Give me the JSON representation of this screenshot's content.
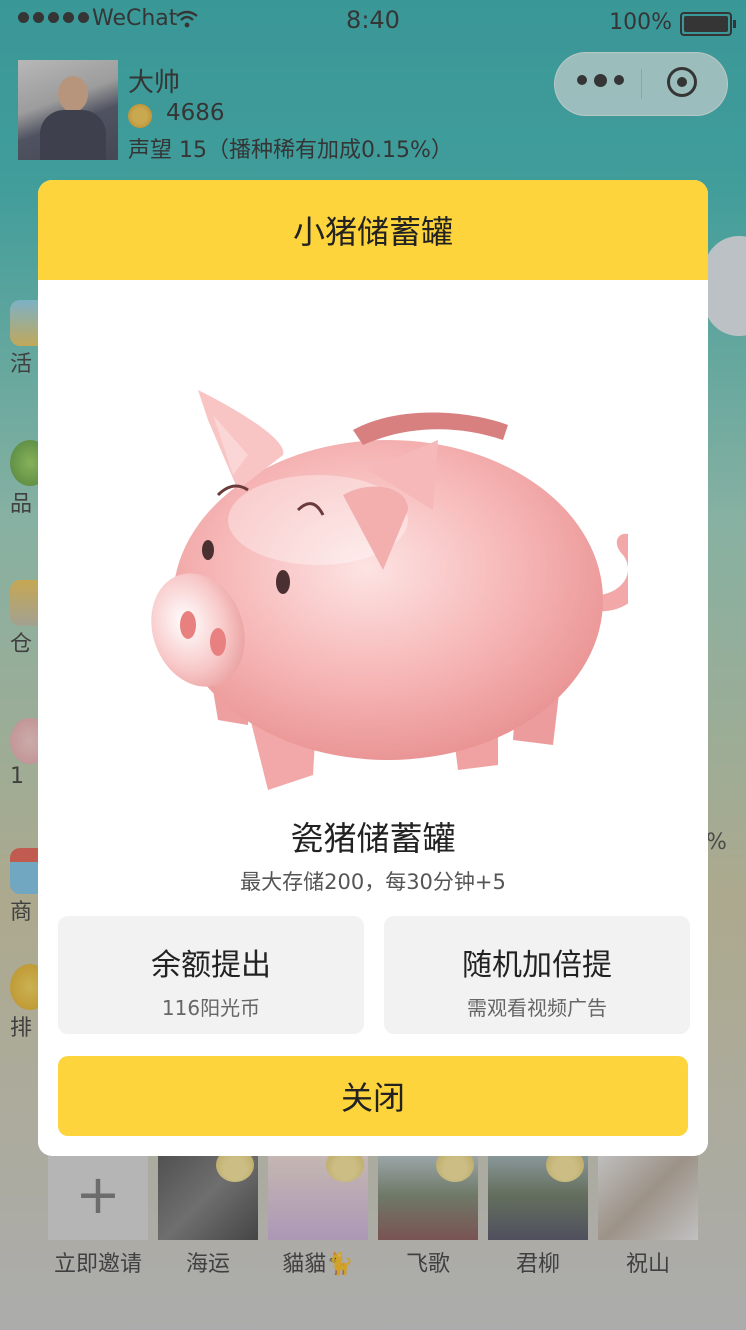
{
  "status_bar": {
    "carrier": "WeChat",
    "time": "8:40",
    "battery": "100%"
  },
  "header": {
    "username": "大帅",
    "coins": "4686",
    "reputation": "声望 15（播种稀有加成0.15%）"
  },
  "side_menu": {
    "labels": [
      "活",
      "品",
      "仓",
      "1",
      "商",
      "排"
    ]
  },
  "right_fragment": "%",
  "modal": {
    "title": "小猪储蓄罐",
    "item_name": "瓷猪储蓄罐",
    "item_desc": "最大存储200，每30分钟+5",
    "withdraw": {
      "title": "余额提出",
      "subtitle": "116阳光币"
    },
    "random_double": {
      "title": "随机加倍提",
      "subtitle": "需观看视频广告"
    },
    "close_label": "关闭"
  },
  "friends": [
    {
      "name": "立即邀请"
    },
    {
      "name": "海运"
    },
    {
      "name": "貓貓🐈"
    },
    {
      "name": "飞歌"
    },
    {
      "name": "君柳"
    },
    {
      "name": "祝山"
    }
  ],
  "colors": {
    "accent": "#fdd43b",
    "teal": "#1aa8a8"
  },
  "icons": {
    "coin": "sun-coin-icon",
    "menu": "more-dots-icon",
    "close_miniprogram": "target-circle-icon",
    "plus": "plus-icon"
  }
}
